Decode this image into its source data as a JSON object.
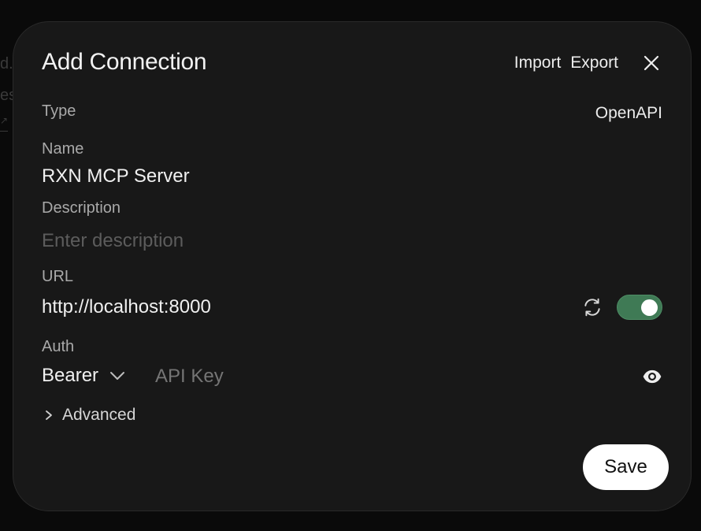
{
  "background": {
    "ghost_a": "d.",
    "ghost_b": "es",
    "ghost_c": "↗"
  },
  "modal": {
    "title": "Add Connection",
    "header": {
      "import_label": "Import",
      "export_label": "Export",
      "close_icon": "close-icon"
    },
    "type": {
      "label": "Type",
      "value": "OpenAPI"
    },
    "name": {
      "label": "Name",
      "value": "RXN MCP Server"
    },
    "description": {
      "label": "Description",
      "placeholder": "Enter description",
      "value": ""
    },
    "url": {
      "label": "URL",
      "value": "http://localhost:8000",
      "refresh_icon": "refresh-icon",
      "enabled": true
    },
    "auth": {
      "label": "Auth",
      "selected": "Bearer",
      "api_key_placeholder": "API Key",
      "api_key_value": "",
      "visibility_icon": "eye-icon"
    },
    "advanced_label": "Advanced",
    "save_label": "Save"
  },
  "colors": {
    "modal_bg": "#181818",
    "toggle_on": "#3f7a55",
    "save_bg": "#ffffff"
  }
}
